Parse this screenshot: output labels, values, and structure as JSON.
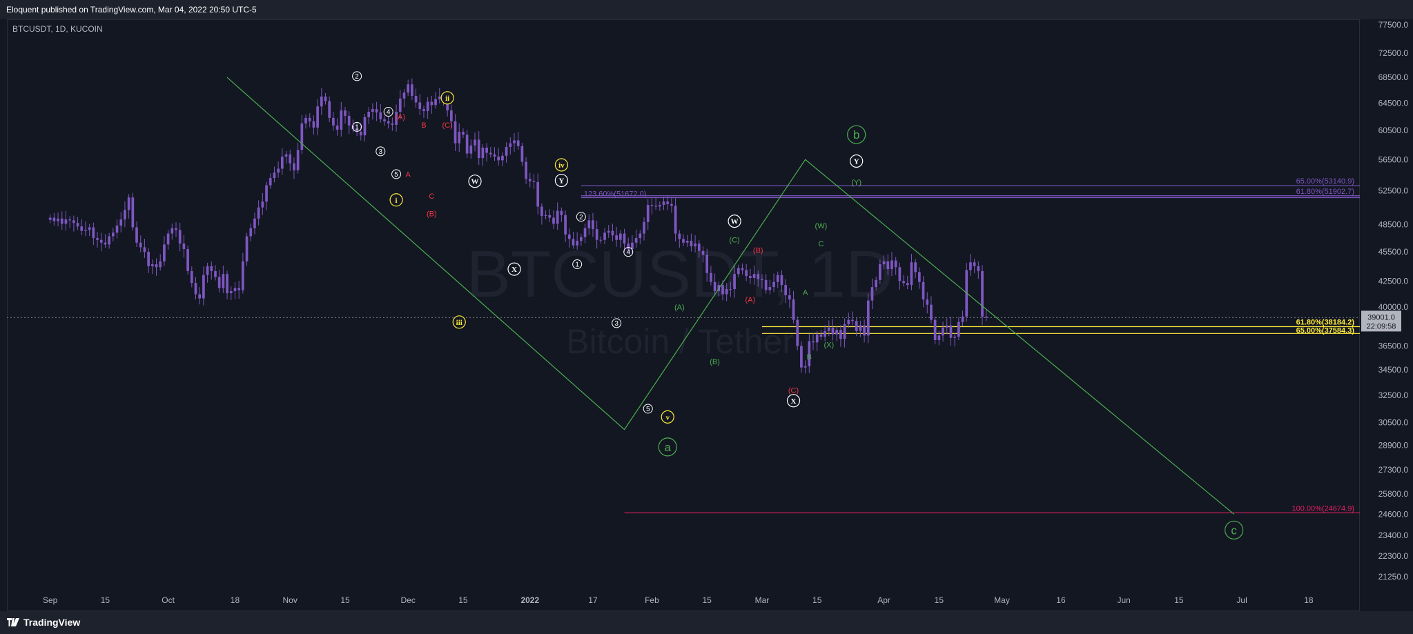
{
  "header": {
    "published_text": "Eloquent published on TradingView.com, Mar 04, 2022 20:50 UTC-5"
  },
  "footer": {
    "brand": "TradingView"
  },
  "chart_data": {
    "type": "candlestick",
    "symbol_label": "BTCUSDT, 1D, KUCOIN",
    "watermark": {
      "line1": "BTCUSDT, 1D",
      "line2": "Bitcoin / Tether"
    },
    "yscale": "log",
    "ylim": [
      20500,
      78500
    ],
    "y_ticks": [
      77500,
      72500,
      68500,
      64500,
      60500,
      56500,
      52500,
      48500,
      45500,
      42500,
      40000,
      36500,
      34500,
      32500,
      30500,
      28900,
      27300,
      25800,
      24600,
      23400,
      22300,
      21250
    ],
    "x_ticks": [
      {
        "label": "Sep",
        "day": 0
      },
      {
        "label": "15",
        "day": 14
      },
      {
        "label": "Oct",
        "day": 30
      },
      {
        "label": "18",
        "day": 47
      },
      {
        "label": "Nov",
        "day": 61
      },
      {
        "label": "15",
        "day": 75
      },
      {
        "label": "Dec",
        "day": 91
      },
      {
        "label": "15",
        "day": 105
      },
      {
        "label": "2022",
        "day": 122
      },
      {
        "label": "17",
        "day": 138
      },
      {
        "label": "Feb",
        "day": 153
      },
      {
        "label": "15",
        "day": 167
      },
      {
        "label": "Mar",
        "day": 181
      },
      {
        "label": "15",
        "day": 195
      },
      {
        "label": "Apr",
        "day": 212
      },
      {
        "label": "15",
        "day": 226
      },
      {
        "label": "May",
        "day": 242
      },
      {
        "label": "16",
        "day": 257
      },
      {
        "label": "Jun",
        "day": 273
      },
      {
        "label": "15",
        "day": 287
      },
      {
        "label": "Jul",
        "day": 303
      },
      {
        "label": "18",
        "day": 320
      }
    ],
    "x_domain": [
      -11,
      333
    ],
    "price_close": [
      49300,
      48900,
      49200,
      48600,
      49100,
      49000,
      48700,
      48300,
      47800,
      47900,
      48200,
      47000,
      46800,
      46500,
      46300,
      47200,
      47600,
      48400,
      49100,
      50200,
      51700,
      48200,
      46500,
      46000,
      45500,
      44000,
      44200,
      43900,
      44500,
      46300,
      47500,
      48100,
      47900,
      46400,
      45800,
      43500,
      42300,
      41200,
      40800,
      43100,
      44000,
      43500,
      42900,
      41800,
      43200,
      41300,
      41500,
      41800,
      41600,
      44500,
      47200,
      48100,
      49200,
      50500,
      51200,
      53200,
      54100,
      54800,
      55300,
      56900,
      57200,
      56000,
      55100,
      57800,
      61500,
      62300,
      61800,
      60900,
      64000,
      65500,
      64800,
      62300,
      61200,
      60600,
      63400,
      62600,
      61200,
      60700,
      60300,
      59800,
      62400,
      63200,
      63600,
      63100,
      62100,
      61800,
      61500,
      61300,
      63200,
      65200,
      66100,
      67400,
      65600,
      64600,
      63600,
      63300,
      64700,
      64200,
      65100,
      65500,
      64900,
      63400,
      61800,
      58700,
      60300,
      59900,
      57300,
      58400,
      59200,
      56700,
      58100,
      57400,
      57200,
      56900,
      56400,
      57000,
      58200,
      58700,
      59100,
      58300,
      56200,
      54000,
      53700,
      53600,
      50600,
      49500,
      49600,
      49300,
      48600,
      50100,
      49600,
      47400,
      46900,
      46200,
      46700,
      47100,
      48100,
      49000,
      48000,
      46800,
      46800,
      47600,
      47800,
      47300,
      46800,
      47500,
      46400,
      45800,
      46500,
      47000,
      47500,
      48800,
      50800,
      50700,
      50600,
      50800,
      51200,
      50900,
      50700,
      47500,
      46900,
      46500,
      46700,
      46100,
      46400,
      45600,
      45200,
      43300,
      42400,
      41500,
      42100,
      41200,
      41700,
      41700,
      43200,
      43800,
      43600,
      43000,
      42800,
      43200,
      42700,
      42600,
      41600,
      41900,
      42400,
      43100,
      42100,
      41100,
      40700,
      38800,
      36500,
      34700,
      34800,
      36900,
      36800,
      37500,
      37300,
      37800,
      38100,
      37500,
      37900,
      37100,
      38400,
      38800,
      38700,
      37800,
      38300,
      37400,
      40600,
      41900,
      42600,
      44200,
      44500,
      43700,
      44600,
      43900,
      42500,
      42300,
      42100,
      44400,
      43400,
      42400,
      40700,
      40200,
      38800,
      37000,
      37400,
      38100,
      38300,
      37200,
      37300,
      38600,
      39100,
      43600,
      44400,
      44000,
      43500,
      39100,
      39000
    ],
    "projection": {
      "label_points": [
        {
          "day": 45,
          "price": 68500
        },
        {
          "day": 146,
          "price": 30000
        },
        {
          "day": 192,
          "price": 56500
        },
        {
          "day": 301,
          "price": 24600
        }
      ]
    },
    "levels": [
      {
        "label": "65.00%(53140.9)",
        "price": 53140.9,
        "color": "#7e57c2",
        "from_day": 135,
        "to_day": 333
      },
      {
        "label": "61.80%(51902.7)",
        "price": 51902.7,
        "color": "#7e57c2",
        "from_day": 135,
        "to_day": 333
      },
      {
        "label": "123.60%(51672.0)",
        "price": 51672.0,
        "color": "#7e57c2",
        "from_day": 135,
        "to_day": 333
      },
      {
        "label": "61.80%(38184.2)",
        "price": 38184.2,
        "color": "#ffeb3b",
        "from_day": 181,
        "to_day": 333
      },
      {
        "label": "65.00%(37584.3)",
        "price": 37584.3,
        "color": "#ffeb3b",
        "from_day": 181,
        "to_day": 333
      },
      {
        "label": "100.00%(24674.9)",
        "price": 24674.9,
        "color": "#e91e63",
        "from_day": 146,
        "to_day": 333
      }
    ],
    "price_marker": {
      "price": 39001.0,
      "label": "39001.0",
      "timer": "22:09:58"
    },
    "wave_labels": [
      {
        "text": "2",
        "day": 78,
        "price": 68700,
        "color": "#ffffff",
        "style": "circle"
      },
      {
        "text": "1",
        "day": 78,
        "price": 61000,
        "color": "#ffffff",
        "style": "circle"
      },
      {
        "text": "4",
        "day": 86,
        "price": 63200,
        "color": "#ffffff",
        "style": "circle"
      },
      {
        "text": "(A)",
        "day": 89,
        "price": 62500,
        "color": "#f23645",
        "style": "text"
      },
      {
        "text": "B",
        "day": 95,
        "price": 61300,
        "color": "#f23645",
        "style": "text"
      },
      {
        "text": "3",
        "day": 84,
        "price": 57600,
        "color": "#ffffff",
        "style": "circle"
      },
      {
        "text": "5",
        "day": 88,
        "price": 54600,
        "color": "#ffffff",
        "style": "circle"
      },
      {
        "text": "A",
        "day": 91,
        "price": 54600,
        "color": "#f23645",
        "style": "text"
      },
      {
        "text": "i",
        "day": 88,
        "price": 51400,
        "color": "#ffeb3b",
        "style": "circle-filled"
      },
      {
        "text": "ii",
        "day": 101,
        "price": 65300,
        "color": "#ffeb3b",
        "style": "circle-filled"
      },
      {
        "text": "(C)",
        "day": 101,
        "price": 61300,
        "color": "#f23645",
        "style": "text"
      },
      {
        "text": "C",
        "day": 97,
        "price": 51900,
        "color": "#f23645",
        "style": "text"
      },
      {
        "text": "(B)",
        "day": 97,
        "price": 49800,
        "color": "#f23645",
        "style": "text"
      },
      {
        "text": "W",
        "day": 108,
        "price": 53700,
        "color": "#ffffff",
        "style": "circle-filled"
      },
      {
        "text": "iii",
        "day": 104,
        "price": 38600,
        "color": "#ffeb3b",
        "style": "circle-filled"
      },
      {
        "text": "iv",
        "day": 130,
        "price": 55800,
        "color": "#ffeb3b",
        "style": "circle-filled"
      },
      {
        "text": "Y",
        "day": 130,
        "price": 53800,
        "color": "#ffffff",
        "style": "circle-filled"
      },
      {
        "text": "X",
        "day": 118,
        "price": 43700,
        "color": "#ffffff",
        "style": "circle-filled"
      },
      {
        "text": "2",
        "day": 135,
        "price": 49400,
        "color": "#ffffff",
        "style": "circle"
      },
      {
        "text": "1",
        "day": 134,
        "price": 44200,
        "color": "#ffffff",
        "style": "circle"
      },
      {
        "text": "4",
        "day": 147,
        "price": 45500,
        "color": "#ffffff",
        "style": "circle"
      },
      {
        "text": "3",
        "day": 144,
        "price": 38500,
        "color": "#ffffff",
        "style": "circle"
      },
      {
        "text": "(A)",
        "day": 160,
        "price": 40000,
        "color": "#4caf50",
        "style": "text"
      },
      {
        "text": "(B)",
        "day": 169,
        "price": 35200,
        "color": "#4caf50",
        "style": "text"
      },
      {
        "text": "5",
        "day": 152,
        "price": 31500,
        "color": "#ffffff",
        "style": "circle"
      },
      {
        "text": "v",
        "day": 157,
        "price": 30900,
        "color": "#ffeb3b",
        "style": "circle-filled"
      },
      {
        "text": "a",
        "day": 157,
        "price": 28800,
        "color": "#4caf50",
        "style": "circle-big"
      },
      {
        "text": "W",
        "day": 174,
        "price": 48900,
        "color": "#ffffff",
        "style": "circle-filled"
      },
      {
        "text": "(C)",
        "day": 174,
        "price": 46800,
        "color": "#4caf50",
        "style": "text"
      },
      {
        "text": "(B)",
        "day": 180,
        "price": 45700,
        "color": "#f23645",
        "style": "text"
      },
      {
        "text": "(A)",
        "day": 178,
        "price": 40700,
        "color": "#f23645",
        "style": "text"
      },
      {
        "text": "(C)",
        "day": 189,
        "price": 32900,
        "color": "#f23645",
        "style": "text"
      },
      {
        "text": "X",
        "day": 189,
        "price": 32100,
        "color": "#ffffff",
        "style": "circle-filled"
      },
      {
        "text": "(W)",
        "day": 196,
        "price": 48400,
        "color": "#4caf50",
        "style": "text"
      },
      {
        "text": "C",
        "day": 196,
        "price": 46400,
        "color": "#4caf50",
        "style": "text"
      },
      {
        "text": "A",
        "day": 192,
        "price": 41400,
        "color": "#4caf50",
        "style": "text"
      },
      {
        "text": "B",
        "day": 193,
        "price": 35600,
        "color": "#4caf50",
        "style": "text"
      },
      {
        "text": "(X)",
        "day": 198,
        "price": 36600,
        "color": "#4caf50",
        "style": "text"
      },
      {
        "text": "b",
        "day": 205,
        "price": 59900,
        "color": "#4caf50",
        "style": "circle-big"
      },
      {
        "text": "Y",
        "day": 205,
        "price": 56300,
        "color": "#ffffff",
        "style": "circle-filled"
      },
      {
        "text": "(Y)",
        "day": 205,
        "price": 53600,
        "color": "#4caf50",
        "style": "text"
      },
      {
        "text": "c",
        "day": 301,
        "price": 23700,
        "color": "#4caf50",
        "style": "circle-big"
      }
    ],
    "colors": {
      "candle": "#7e57c2",
      "background": "#131722",
      "grid": "#2a2e39",
      "projection_line": "#4caf50",
      "axis_text": "#b2b5be"
    }
  }
}
